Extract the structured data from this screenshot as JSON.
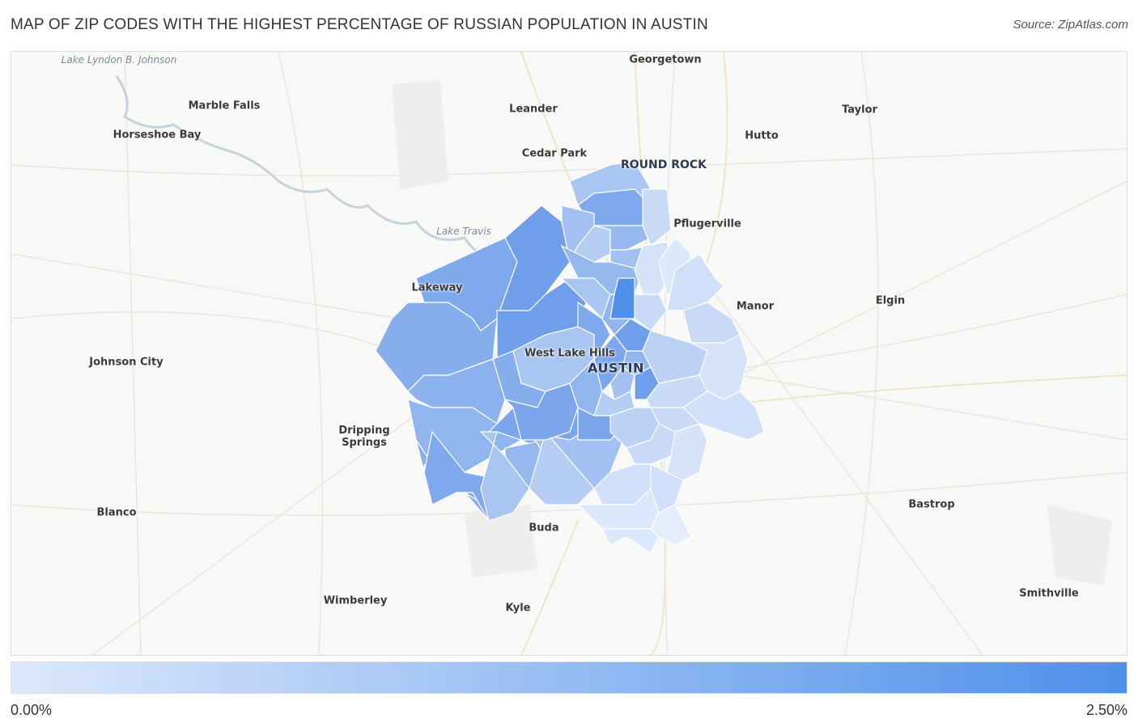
{
  "title": "MAP OF ZIP CODES WITH THE HIGHEST PERCENTAGE OF RUSSIAN POPULATION IN AUSTIN",
  "source": "Source: ZipAtlas.com",
  "places": {
    "lake_lbj": "Lake Lyndon B. Johnson",
    "georgetown": "Georgetown",
    "marble_falls": "Marble Falls",
    "leander": "Leander",
    "taylor": "Taylor",
    "horseshoe_bay": "Horseshoe Bay",
    "hutto": "Hutto",
    "cedar_park": "Cedar Park",
    "round_rock": "ROUND ROCK",
    "pflugerville": "Pflugerville",
    "lake_travis": "Lake Travis",
    "lakeway": "Lakeway",
    "manor": "Manor",
    "elgin": "Elgin",
    "west_lake_hills": "West Lake Hills",
    "johnson_city": "Johnson City",
    "austin": "AUSTIN",
    "dripping_springs": "Dripping Springs",
    "blanco": "Blanco",
    "bastrop": "Bastrop",
    "buda": "Buda",
    "wimberley": "Wimberley",
    "kyle": "Kyle",
    "smithville": "Smithville"
  },
  "legend": {
    "min_label": "0.00%",
    "max_label": "2.50%",
    "min_color": "#dce8fb",
    "max_color": "#4f90ea"
  }
}
